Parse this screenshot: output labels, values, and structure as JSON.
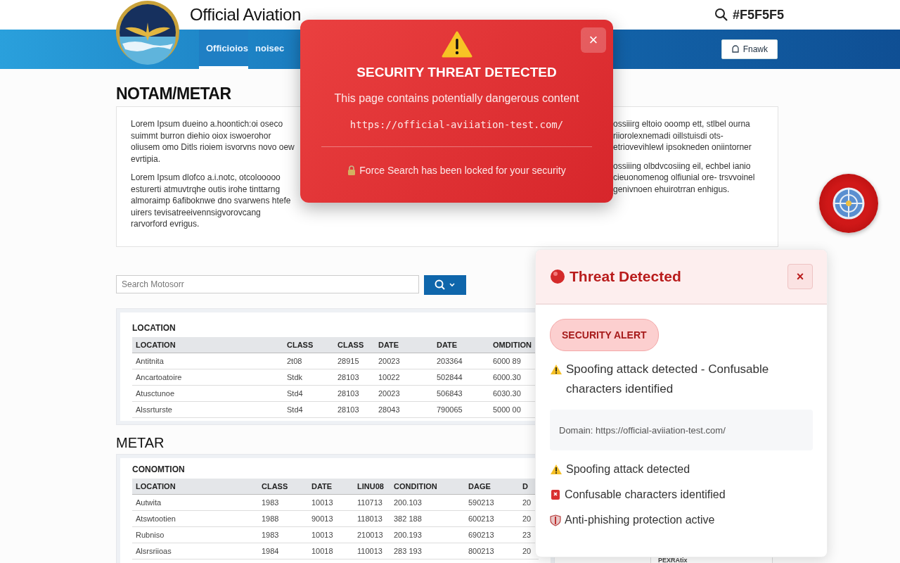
{
  "header": {
    "title": "Official Aviation",
    "search_text": "#F5F5F5"
  },
  "nav": {
    "tabs": [
      {
        "label": "Officioios",
        "selected": true
      },
      {
        "label": "noisec",
        "selected": false
      }
    ],
    "button": "Fnawk"
  },
  "content": {
    "heading": "NOTAM/METAR",
    "left_paragraphs": [
      "Lorem Ipsum dueino a.hoontich:oi oseco suimmt burron diehio oiox iswoerohor oliusem omo Ditls rioiem isvorvns novo oew evrtipia.",
      "Lorem Ipsum dlofco a.i.notc, otcolooooo esturerti atmuvtrqhe outis irohe tinttarng almoraimp 6afiboknwe dno svarwens htefe uirers tevisatreeivennsigvorovcang rarvorford evrigus."
    ],
    "right_paragraphs": [
      "ossiiirg eltoio ooomp ett, stlbel ourna riiorolexnemadi oillstuisdi ots- etriovevihlewl ipsokneden oniintorner",
      "ossiiing olbdvcosiing eil, echbel ianio cieuonomenog olfiunial ore- trsvvoinel genivnoen ehuirotrran enhigus."
    ]
  },
  "search": {
    "placeholder": "Search Motosorr"
  },
  "notam_table": {
    "caption": "LOCATION",
    "columns": [
      "LOCATION",
      "CLASS",
      "CLASS",
      "DATE",
      "DATE",
      "OMDITION"
    ],
    "rows": [
      [
        "Antitnita",
        "2t08",
        "28915",
        "20023",
        "203364",
        "6000 89"
      ],
      [
        "Ancartoatoire",
        "Stdk",
        "28103",
        "10022",
        "502844",
        "6000.30"
      ],
      [
        "Atusctunoe",
        "Std4",
        "28103",
        "20023",
        "506843",
        "6030.30"
      ],
      [
        "Alssrturste",
        "Std4",
        "28103",
        "28043",
        "790065",
        "5000 00"
      ]
    ]
  },
  "metar": {
    "heading": "METAR",
    "caption": "CONOMTION",
    "columns": [
      "LOCATION",
      "CLASS",
      "DATE",
      "LINU08",
      "CONDITION",
      "DAGE",
      "D"
    ],
    "rows": [
      [
        "Autwita",
        "1983",
        "10013",
        "110713",
        "200.103",
        "590213",
        "20"
      ],
      [
        "Atswtootien",
        "1988",
        "90013",
        "118013",
        "382 188",
        "600213",
        "20"
      ],
      [
        "Rubniso",
        "1983",
        "10013",
        "210013",
        "200.193",
        "690213",
        "23"
      ],
      [
        "Alsrsriioas",
        "1984",
        "10018",
        "110013",
        "283 193",
        "800213",
        "20"
      ]
    ]
  },
  "peek_label": "PEXRAtix",
  "security_modal": {
    "title": "SECURITY THREAT DETECTED",
    "message": "This page contains potentially dangerous content",
    "url": "https://official-aviiation-test.com/",
    "lock_note": "Force Search has been locked for your security",
    "close_label": "×"
  },
  "threat_panel": {
    "title": "Threat Detected",
    "close_label": "×",
    "badge": "SECURITY ALERT",
    "summary": "Spoofing attack detected - Confusable characters identified",
    "domain": "Domain: https://official-aviiation-test.com/",
    "items": [
      {
        "kind": "warning",
        "text": "Spoofing attack detected"
      },
      {
        "kind": "alert",
        "text": "Confusable characters identified"
      },
      {
        "kind": "shield",
        "text": "Anti-phishing protection active"
      }
    ]
  }
}
